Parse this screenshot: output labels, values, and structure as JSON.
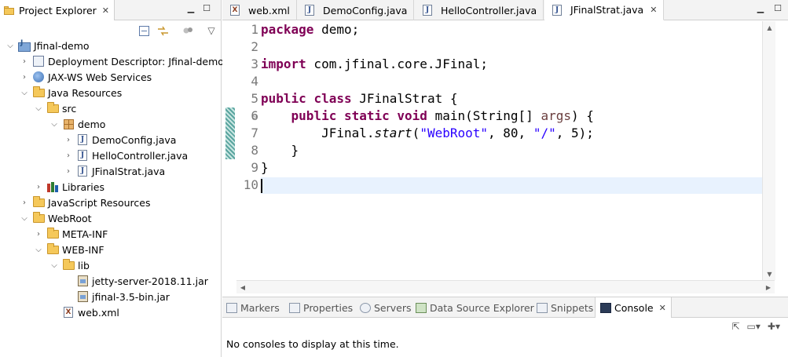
{
  "explorer": {
    "tab_label": "Project Explorer",
    "tree": [
      {
        "label": "Jfinal-demo",
        "icon": "project-icon",
        "twisty": "expanded",
        "indent": 0
      },
      {
        "label": "Deployment Descriptor: Jfinal-demo",
        "icon": "deployment-descriptor-icon",
        "twisty": "collapsed",
        "indent": 1
      },
      {
        "label": "JAX-WS Web Services",
        "icon": "web-services-icon",
        "twisty": "collapsed",
        "indent": 1
      },
      {
        "label": "Java Resources",
        "icon": "java-resources-icon",
        "twisty": "expanded",
        "indent": 1
      },
      {
        "label": "src",
        "icon": "source-folder-icon",
        "twisty": "expanded",
        "indent": 2
      },
      {
        "label": "demo",
        "icon": "package-icon",
        "twisty": "expanded",
        "indent": 3
      },
      {
        "label": "DemoConfig.java",
        "icon": "java-file-icon",
        "twisty": "collapsed",
        "indent": 4
      },
      {
        "label": "HelloController.java",
        "icon": "java-file-icon",
        "twisty": "collapsed",
        "indent": 4
      },
      {
        "label": "JFinalStrat.java",
        "icon": "java-file-icon",
        "twisty": "collapsed",
        "indent": 4
      },
      {
        "label": "Libraries",
        "icon": "libraries-icon",
        "twisty": "collapsed",
        "indent": 2
      },
      {
        "label": "JavaScript Resources",
        "icon": "javascript-resources-icon",
        "twisty": "collapsed",
        "indent": 1
      },
      {
        "label": "WebRoot",
        "icon": "folder-icon",
        "twisty": "expanded",
        "indent": 1
      },
      {
        "label": "META-INF",
        "icon": "folder-icon",
        "twisty": "collapsed",
        "indent": 2
      },
      {
        "label": "WEB-INF",
        "icon": "folder-icon",
        "twisty": "expanded",
        "indent": 2
      },
      {
        "label": "lib",
        "icon": "folder-icon",
        "twisty": "expanded",
        "indent": 3
      },
      {
        "label": "jetty-server-2018.11.jar",
        "icon": "jar-icon",
        "twisty": "none",
        "indent": 4
      },
      {
        "label": "jfinal-3.5-bin.jar",
        "icon": "jar-icon",
        "twisty": "none",
        "indent": 4
      },
      {
        "label": "web.xml",
        "icon": "xml-file-icon",
        "twisty": "none",
        "indent": 3
      }
    ]
  },
  "editor": {
    "tabs": [
      {
        "label": "web.xml",
        "icon": "xml-file-icon",
        "active": false
      },
      {
        "label": "DemoConfig.java",
        "icon": "java-file-icon",
        "active": false
      },
      {
        "label": "HelloController.java",
        "icon": "java-file-icon",
        "active": false
      },
      {
        "label": "JFinalStrat.java",
        "icon": "java-file-icon",
        "active": true
      }
    ],
    "line_numbers": [
      "1",
      "2",
      "3",
      "4",
      "5",
      "6",
      "7",
      "8",
      "9",
      "10"
    ],
    "code": {
      "l1_kw": "package",
      "l1_rest": " demo;",
      "l3_kw": "import",
      "l3_rest": " com.jfinal.core.JFinal;",
      "l5_kw1": "public",
      "l5_kw2": "class",
      "l5_rest": " JFinalStrat {",
      "l6_indent": "    ",
      "l6_kw1": "public",
      "l6_kw2": "static",
      "l6_kw3": "void",
      "l6_mid": " main(String[] ",
      "l6_param": "args",
      "l6_end": ") {",
      "l7_indent": "        ",
      "l7_a": "JFinal.",
      "l7_method": "start",
      "l7_b": "(",
      "l7_s1": "\"WebRoot\"",
      "l7_c": ", 80, ",
      "l7_s2": "\"/\"",
      "l7_d": ", 5);",
      "l8": "    }",
      "l9": "}"
    }
  },
  "bottom": {
    "tabs": [
      {
        "label": "Markers",
        "icon": "markers-icon"
      },
      {
        "label": "Properties",
        "icon": "properties-icon"
      },
      {
        "label": "Servers",
        "icon": "servers-icon"
      },
      {
        "label": "Data Source Explorer",
        "icon": "data-source-icon"
      },
      {
        "label": "Snippets",
        "icon": "snippets-icon"
      },
      {
        "label": "Console",
        "icon": "console-icon",
        "active": true
      }
    ],
    "console_message": "No consoles to display at this time."
  }
}
